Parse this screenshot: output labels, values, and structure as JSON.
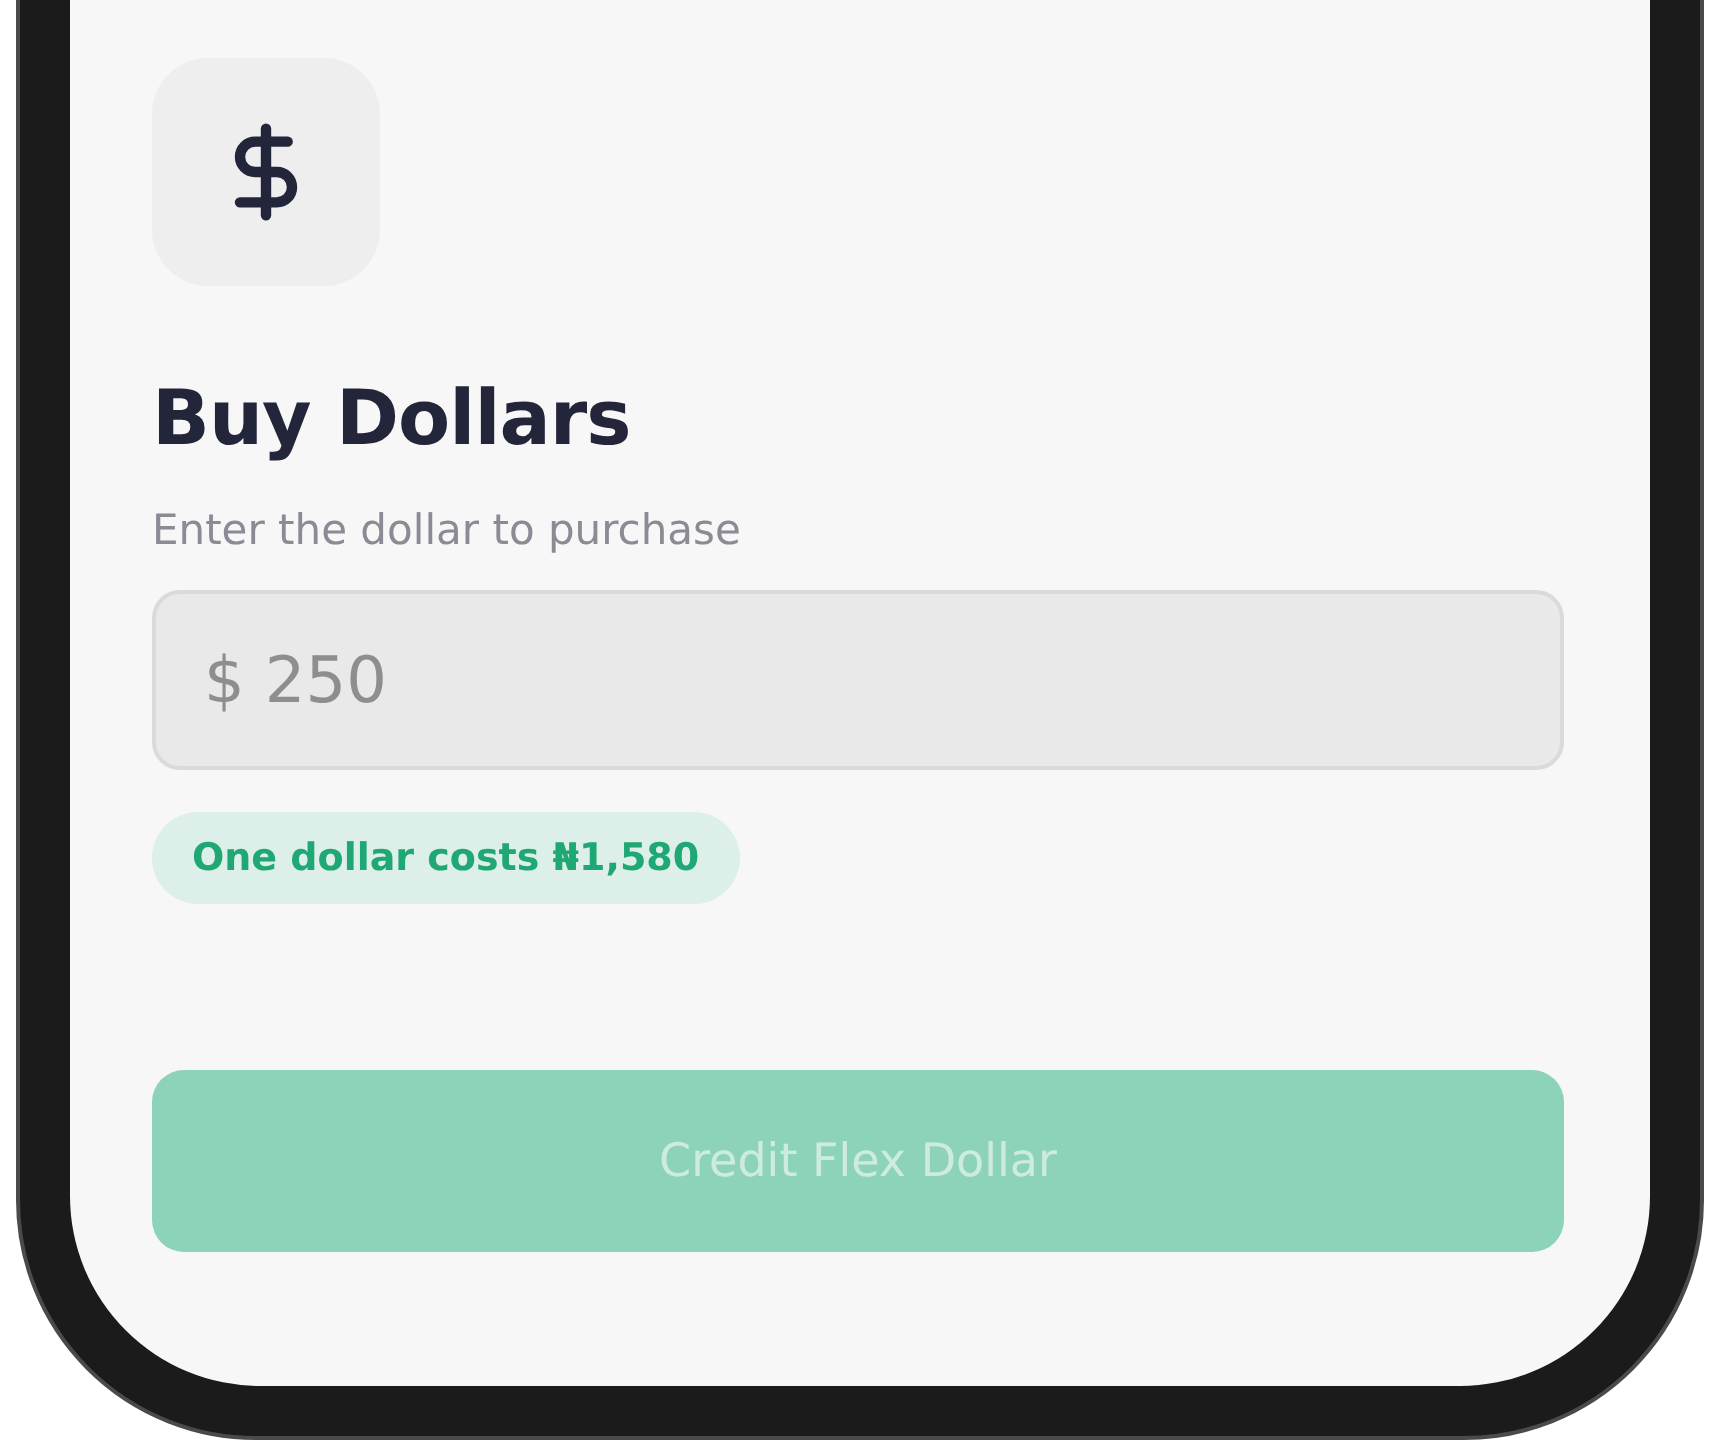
{
  "title": "Buy Dollars",
  "subtitle": "Enter the dollar to purchase",
  "amount_field": {
    "prefix": "$",
    "placeholder": "250"
  },
  "rate_note": "One dollar costs ₦1,580",
  "submit_button": {
    "label": "Credit Flex Dollar",
    "disabled": true
  }
}
